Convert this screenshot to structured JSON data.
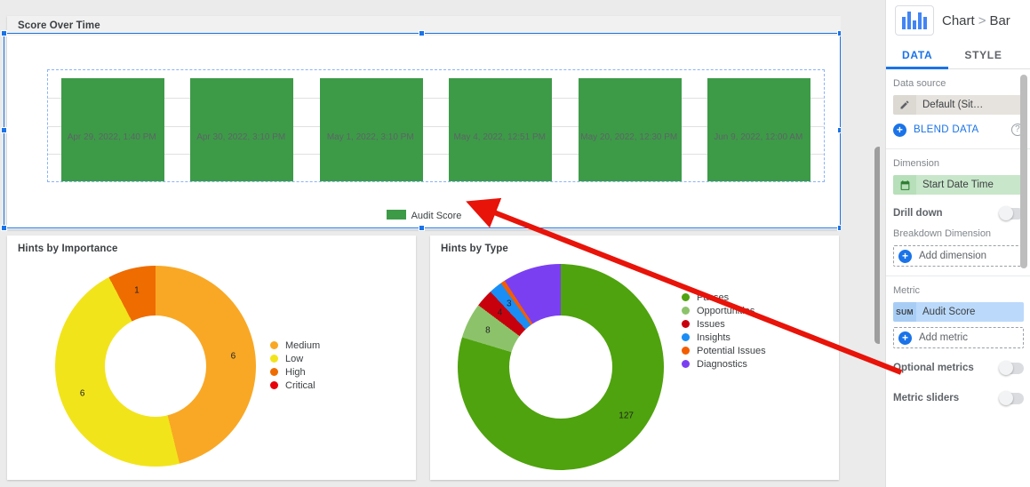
{
  "canvas": {
    "score_card": {
      "title": "Score Over Time",
      "legend_label": "Audit Score"
    },
    "importance_card": {
      "title": "Hints by Importance"
    },
    "type_card": {
      "title": "Hints by Type"
    }
  },
  "panel": {
    "chart_type_icon": "bar-chart-icon",
    "breadcrumb": {
      "root": "Chart",
      "separator": ">",
      "current": "Bar"
    },
    "tabs": [
      {
        "label": "DATA",
        "active": true
      },
      {
        "label": "STYLE",
        "active": false
      }
    ],
    "data_source": {
      "section_label": "Data source",
      "chip_icon": "pencil-icon",
      "chip_label": "Default (Sit…",
      "blend_label": "BLEND DATA",
      "help_icon": "help-icon"
    },
    "dimension": {
      "section_label": "Dimension",
      "chip_icon": "calendar-icon",
      "chip_label": "Start Date Time",
      "drill_down_label": "Drill down",
      "drill_down_on": false,
      "breakdown_label": "Breakdown Dimension",
      "add_dimension_label": "Add dimension"
    },
    "metric": {
      "section_label": "Metric",
      "chip_agg": "SUM",
      "chip_label": "Audit Score",
      "add_metric_label": "Add metric",
      "optional_metrics_label": "Optional metrics",
      "optional_metrics_on": false,
      "metric_sliders_label": "Metric sliders",
      "metric_sliders_on": false
    }
  },
  "colors": {
    "bar_green": "#3d9b48",
    "accent_blue": "#1a73e8",
    "selection_blue": "#1a73e8",
    "arrow_red": "#e81309",
    "medium_orange": "#f9a825",
    "low_yellow": "#f2e41b",
    "high_orange": "#ef6c00",
    "critical_red": "#e8000b",
    "passes_green": "#4fa30e",
    "opportunities_green": "#8cc36a",
    "issues_red": "#c8000d",
    "insights_blue": "#1a8ef5",
    "potential_orange": "#f45c00",
    "diagnostics_purple": "#7b3ff2"
  },
  "chart_data": [
    {
      "type": "bar",
      "title": "Score Over Time",
      "xlabel": "",
      "ylabel": "",
      "ylim": [
        0,
        100
      ],
      "yticks": [
        0,
        25,
        50,
        75,
        100
      ],
      "grid": true,
      "legend": [
        "Audit Score"
      ],
      "legend_position": "bottom",
      "categories": [
        "Apr 29, 2022, 1:40 PM",
        "Apr 30, 2022, 3:10 PM",
        "May 1, 2022, 3:10 PM",
        "May 4, 2022, 12:51 PM",
        "May 20, 2022, 12:30 PM",
        "Jun 9, 2022, 12:00 AM"
      ],
      "series": [
        {
          "name": "Audit Score",
          "color": "#3d9b48",
          "values": [
            93,
            93,
            93,
            93,
            93,
            93
          ]
        }
      ]
    },
    {
      "type": "pie",
      "title": "Hints by Importance",
      "legend_position": "right",
      "labels": [
        "Medium",
        "Low",
        "High",
        "Critical"
      ],
      "values": [
        6,
        6,
        1,
        0
      ],
      "colors": [
        "#f9a825",
        "#f2e41b",
        "#ef6c00",
        "#e8000b"
      ],
      "data_labels": [
        "6",
        "6",
        "1",
        ""
      ]
    },
    {
      "type": "pie",
      "title": "Hints by Type",
      "legend_position": "right",
      "labels": [
        "Passes",
        "Opportunities",
        "Issues",
        "Insights",
        "Potential Issues",
        "Diagnostics"
      ],
      "values": [
        127,
        8,
        4,
        3,
        1,
        0
      ],
      "colors": [
        "#4fa30e",
        "#8cc36a",
        "#c8000d",
        "#1a8ef5",
        "#f45c00",
        "#7b3ff2"
      ],
      "data_labels": [
        "127",
        "8",
        "4",
        "3",
        "",
        ""
      ]
    }
  ]
}
